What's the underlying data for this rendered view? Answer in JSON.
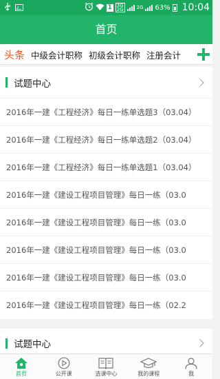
{
  "statusbar": {
    "net_top": "3G",
    "net_bottom": "2G",
    "net2": "2G",
    "sim": "1",
    "battery": "63%",
    "time": "10:04"
  },
  "header": {
    "title": "首页"
  },
  "tabs": [
    "头条",
    "中级会计职称",
    "初级会计职称",
    "注册会计"
  ],
  "sections": [
    {
      "title": "试题中心",
      "items": [
        "2016年一建《工程经济》每日一练单选题3（03.04）",
        "2016年一建《工程经济》每日一练单选题2（03.04）",
        "2016年一建《工程经济》每日一练单选题1（03.04）",
        "2016年一建《建设工程项目管理》每日一练（03.0",
        "2016年一建《建设工程项目管理》每日一练（03.0",
        "2016年一建《建设工程项目管理》每日一练（03.0",
        "2016年一建《建设工程项目管理》每日一练（03.0",
        "2016年一建《建设工程项目管理》每日一练（02.2"
      ]
    },
    {
      "title": "试题中心"
    }
  ],
  "bottom_nav": [
    {
      "label": "首页",
      "icon": "home-icon"
    },
    {
      "label": "公开课",
      "icon": "play-icon"
    },
    {
      "label": "选课中心",
      "icon": "book-icon"
    },
    {
      "label": "我的课程",
      "icon": "graduation-cap-icon"
    },
    {
      "label": "我",
      "icon": "person-icon"
    }
  ],
  "colors": {
    "accent": "#22b46a",
    "statusbar": "#1aa85c",
    "active_tab": "#f05a24"
  }
}
